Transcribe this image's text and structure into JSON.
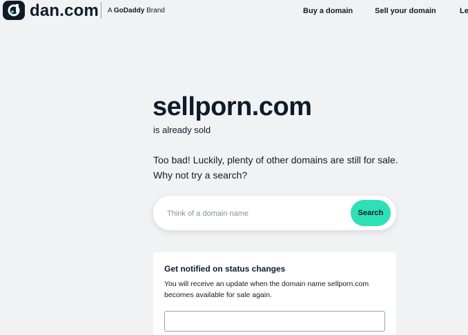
{
  "header": {
    "logo_text": "dan.com",
    "brand_prefix": "A",
    "brand_name": "GoDaddy",
    "brand_suffix": "Brand",
    "nav": [
      {
        "label": "Buy a domain"
      },
      {
        "label": "Sell your domain"
      },
      {
        "label": "Le"
      }
    ]
  },
  "main": {
    "domain": "sellporn.com",
    "status": "is already sold",
    "message": "Too bad! Luckily, plenty of other domains are still for sale. Why not try a search?"
  },
  "search": {
    "placeholder": "Think of a domain name",
    "button_label": "Search",
    "accent_color": "#2ee0b5"
  },
  "notify": {
    "title": "Get notified on status changes",
    "description": "You will receive an update when the domain name sellporn.com becomes available for sale again.",
    "email_value": ""
  }
}
